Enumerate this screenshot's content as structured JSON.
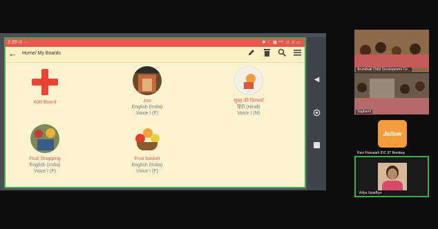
{
  "phone_status": {
    "time": "2:29",
    "time_suffix": "⊙ ···",
    "right": "✱ ☾ ▩ ⁴ᴳ .ıl .ıl ▭"
  },
  "app": {
    "breadcrumb": "Home/ My Boards",
    "icons": [
      "pencil-icon",
      "trash-icon",
      "search-icon",
      "menu-icon"
    ]
  },
  "boards": [
    {
      "name": "Add Board",
      "type": "add"
    },
    {
      "name": "zoo",
      "line2": "English (India)",
      "line3": "Voice I (F)"
    },
    {
      "name": "सुबह की दिनचर्या",
      "line2": "हिंदी (Hindi)",
      "line3": "Voice I (M)"
    },
    {
      "name": "Fruit Shopping",
      "line2": "English (India)",
      "line3": "Voice I (F)"
    },
    {
      "name": "Fruit basket",
      "line2": "English (India)",
      "line3": "Voice I (F)"
    }
  ],
  "participants": [
    {
      "name": "Arundhati Child Development Ce..."
    },
    {
      "name": "Sughand"
    },
    {
      "name": "Ravi Poovaiah IDC IIT Bombay",
      "logo_text": "Jellow"
    },
    {
      "name": "Vidya Upadhye"
    }
  ],
  "colors": {
    "accent_green": "#3fae49",
    "status_red": "#e8574d",
    "board_bg": "#fbf3cf",
    "label_red": "#e85a4f"
  }
}
